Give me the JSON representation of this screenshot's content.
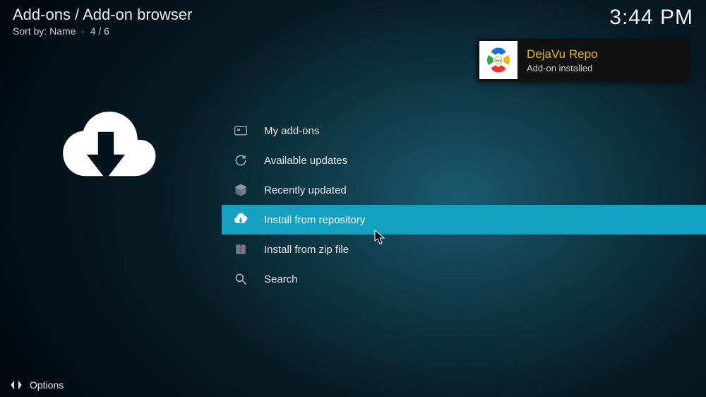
{
  "header": {
    "breadcrumb": "Add-ons / Add-on browser",
    "sort_label": "Sort by: Name",
    "position": "4 / 6",
    "clock": "3:44 PM"
  },
  "menu": {
    "items": [
      {
        "label": "My add-ons",
        "icon": "addons-icon"
      },
      {
        "label": "Available updates",
        "icon": "refresh-icon"
      },
      {
        "label": "Recently updated",
        "icon": "box-icon"
      },
      {
        "label": "Install from repository",
        "icon": "cloud-download-icon",
        "selected": true
      },
      {
        "label": "Install from zip file",
        "icon": "zip-icon"
      },
      {
        "label": "Search",
        "icon": "search-icon"
      }
    ]
  },
  "notification": {
    "title": "DejaVu Repo",
    "subtitle": "Add-on installed"
  },
  "footer": {
    "options_label": "Options"
  },
  "colors": {
    "accent": "#12a2c4",
    "notif_title": "#e6b800"
  }
}
